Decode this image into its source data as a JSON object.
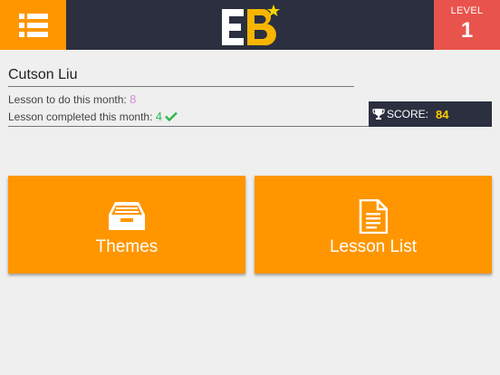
{
  "header": {
    "menu_icon": "list-menu-icon",
    "logo_text": "EB",
    "level_label": "LEVEL",
    "level_value": "1",
    "colors": {
      "bar": "#2b2f3f",
      "accent": "#ff9600",
      "level": "#e8544b"
    }
  },
  "user": {
    "name": "Cutson Liu",
    "todo_label": "Lesson to do this month:",
    "todo_value": "8",
    "completed_label": "Lesson completed this month:",
    "completed_value": "4"
  },
  "score": {
    "icon": "trophy-icon",
    "label": "SCORE:",
    "value": "84"
  },
  "tiles": [
    {
      "label": "Themes",
      "icon": "inbox-tray-icon"
    },
    {
      "label": "Lesson List",
      "icon": "document-icon"
    }
  ]
}
